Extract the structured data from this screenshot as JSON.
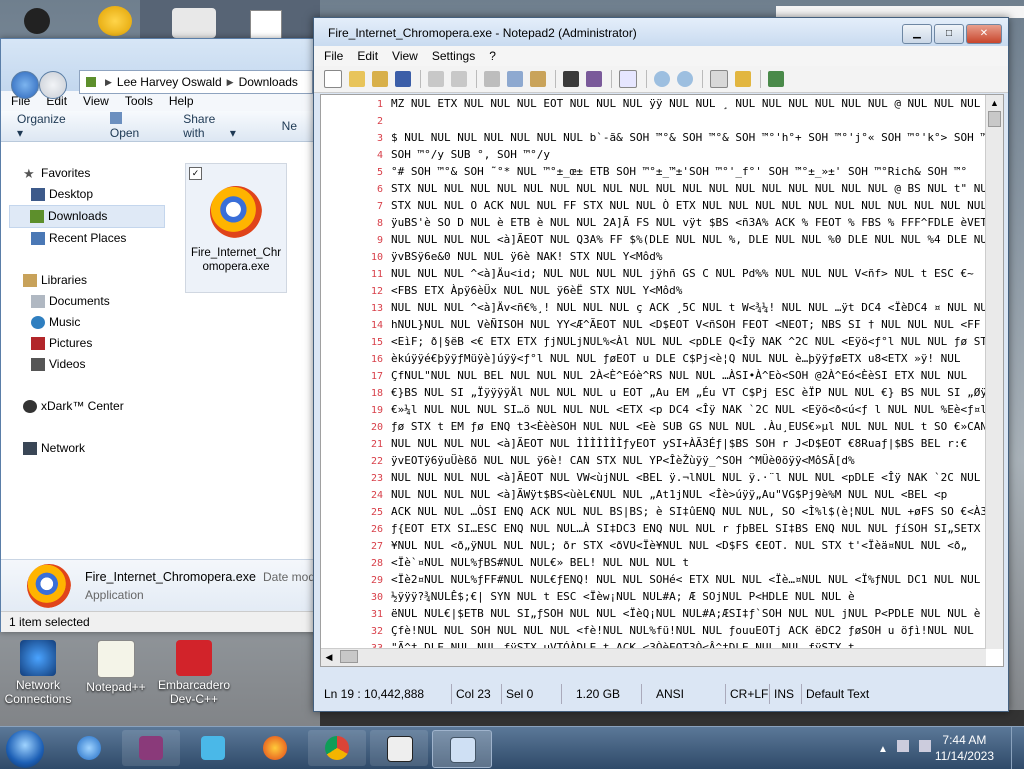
{
  "desktop": {
    "icons": [
      {
        "label": "Network Connections"
      },
      {
        "label": "Notepad++"
      },
      {
        "label": "Embarcadero Dev-C++"
      }
    ]
  },
  "explorer": {
    "breadcrumb": [
      "Lee Harvey Oswald",
      "Downloads"
    ],
    "menu": [
      "File",
      "Edit",
      "View",
      "Tools",
      "Help"
    ],
    "commands": [
      "Organize",
      "Open",
      "Share with",
      "Ne"
    ],
    "nav": {
      "favorites_label": "Favorites",
      "favorites": [
        "Desktop",
        "Downloads",
        "Recent Places"
      ],
      "libraries_label": "Libraries",
      "libraries": [
        "Documents",
        "Music",
        "Pictures",
        "Videos"
      ],
      "xdark": "xDark™ Center",
      "network": "Network"
    },
    "file": {
      "name_line1": "Fire_Internet_Chr",
      "name_line2": "omopera.exe"
    },
    "detail": {
      "name": "Fire_Internet_Chromopera.exe",
      "date_label": "Date mod",
      "type": "Application"
    },
    "status": "1 item selected"
  },
  "notepad": {
    "title": "Fire_Internet_Chromopera.exe - Notepad2 (Administrator)",
    "menu": [
      "File",
      "Edit",
      "View",
      "Settings",
      "?"
    ],
    "lines": [
      {
        "n": "1",
        "t": "MZ NUL ETX NUL NUL NUL EOT NUL NUL NUL ÿÿ NUL NUL ¸ NUL NUL NUL NUL NUL NUL @ NUL NUL NUL NUL"
      },
      {
        "n": "2",
        "t": ""
      },
      {
        "n": "3",
        "t": "$ NUL NUL NUL NUL NUL NUL NUL b`-ã& SOH ™°& SOH ™°& SOH ™°'h°+ SOH ™°'j°« SOH ™°'k°> SOH ™° ¡^"
      },
      {
        "n": "4",
        "t": "SOH ™°/y SUB °, SOH ™°/y"
      },
      {
        "n": "5",
        "t": "°# SOH ™°& SOH ˜°* NUL ™°±_œ± ETB SOH ™°±_™±'SOH ™°'_f°' SOH ™°±_»±' SOH ™°Rich& SOH ™°"
      },
      {
        "n": "6",
        "t": "STX NUL NUL NUL NUL NUL NUL NUL NUL NUL NUL NUL NUL NUL NUL NUL NUL NUL NUL @ BS NUL t\" NUL NUL Aª"
      },
      {
        "n": "7",
        "t": "STX NUL NUL O ACK NUL NUL FF STX NUL NUL Ò ETX NUL NUL NUL NUL NUL NUL NUL NUL NUL NUL NUL NUL @"
      },
      {
        "n": "8",
        "t": "ÿuBS'è SO D NUL è ETB è NUL NUL 2A]Ã FS NUL vÿt $BS <ñ3A% ACK % FEOT % FBS % FFF^FDLE èVETX NUL NUL"
      },
      {
        "n": "9",
        "t": "NUL NUL NUL NUL <à]ÃEOT NUL Q3A% FF $%(DLE NUL NUL %, DLE NUL NUL %0 DLE NUL NUL %4 DLE NUL NUL"
      },
      {
        "n": "10",
        "t": "ÿvBSÿ6e&0 NUL NUL ÿ6è NAK! STX NUL Y<Môd%"
      },
      {
        "n": "11",
        "t": "NUL NUL NUL ^<à]Äu<id; NUL NUL NUL NUL jÿhñ GS C NUL Pd%% NUL NUL NUL V<ñf> NUL t ESC €~"
      },
      {
        "n": "12",
        "t": "<FBS ETX Àpÿ6èÜx NUL NUL ÿ6èË STX NUL Y<Môd%"
      },
      {
        "n": "13",
        "t": "NUL NUL NUL ^<à]Äv<ñ€%¸! NUL NUL NUL ç ACK ¸5C NUL t W<¾¼! NUL NUL …ÿt DC4 <ÏèDC4 ¤ NUL NUL"
      },
      {
        "n": "14",
        "t": "hNUL}NUL NUL VèÑISOH NUL YY<Æ^ÃEOT NUL <D$EOT V<ñSOH FEOT <NEOT; NBS SI † NUL NUL NUL <FF"
      },
      {
        "n": "15",
        "t": "<EìF; ð|§ëB <€ ETX ETX ƒjNULjNUL%<Àl NUL NUL <pDLE Q<Îÿ NAK ^2C NUL <Eÿö<ƒ°l NUL NUL ƒø STX"
      },
      {
        "n": "16",
        "t": "èkúÿÿé€þÿÿƒMüÿè]úÿÿ<ƒ°l NUL NUL ƒøEOT u DLE C$Pj<è¦Q NUL NUL è…þÿÿƒøETX u8<ETX »ÿ! NUL"
      },
      {
        "n": "17",
        "t": "ÇfNUL\"NUL NUL BEL NUL NUL NUL 2À<È^Eóè^RS NUL NUL …ÀSI•À^Eò<SOH @2À^Eó<ÈèSI ETX NUL NUL"
      },
      {
        "n": "18",
        "t": "€}BS NUL SI „ÏÿÿÿÿÄl NUL NUL NUL u EOT „Au EM „Éu VT C$Pj ESC èÏP NUL NUL €} BS NUL SI „Øÿÿÿ€}"
      },
      {
        "n": "19",
        "t": "€»¼l NUL NUL NUL SI…ö NUL NUL NUL <ETX <p DC4 <Îÿ NAK `2C NUL <Eÿö<ð<ú<ƒ l NUL NUL %Eè<ƒ¤l NUL"
      },
      {
        "n": "20",
        "t": "ƒø STX t EM ƒø ENQ t3<ÈèèSOH NUL NUL <Eè SUB GS NUL NUL .Àu¸EUS€»µl NUL NUL NUL t SO €»CAN3 NUL"
      },
      {
        "n": "21",
        "t": "NUL NUL NUL NUL <à]ÃEOT NUL ÌÌÌÌÌÌÌƒyEOT ySI+ÀÃ3Éƒ|$BS SOH r J<D$EOT €8Ruaƒ|$BS BEL r:€"
      },
      {
        "n": "22",
        "t": "ÿvEOTÿ6ÿuÜèßõ NUL NUL ÿ6è! CAN STX NUL YP<ÎèŽùÿÿ_^SOH ^MÜè0öÿÿ<MôSÃ[d%"
      },
      {
        "n": "23",
        "t": "NUL NUL NUL NUL <à]ÃEOT NUL VW<ùjNUL <BEL ÿ.¬lNUL NUL ÿ.·¨l NUL NUL <pDLE <Îÿ NAK `2C NUL <Ïÿ"
      },
      {
        "n": "24",
        "t": "NUL NUL NUL NUL <à]ÃWÿt$BS<ùèL€NUL NUL „At1jNUL <Îè>úÿÿ„Au\"VG$Pj9è%M NUL NUL <BEL <p"
      },
      {
        "n": "25",
        "t": "ACK NUL NUL …ÒSI ENQ ACK NUL NUL BS|BS; è SI‡ûENQ NUL NUL, SO <Ì%l$(è¦NUL NUL +øFS SO €<À3È%D$"
      },
      {
        "n": "26",
        "t": "ƒ{EOT ETX SI…ESC ENQ NUL NUL…À SI‡DC3 ENQ NUL NUL r ƒþBEL SI‡BS ENQ NUL NUL ƒíSOH SI„SETX"
      },
      {
        "n": "27",
        "t": "¥NUL NUL <ð„ÿNUL NUL NUL; ðr STX <ðVU<Ïè¥NUL NUL <D$FS €EOT. NUL STX t'<Ïèä¤NUL NUL <ð„"
      },
      {
        "n": "28",
        "t": "<Ïè`¤NUL NUL%ƒBS#NUL NUL€» BEL! NUL NUL NUL t"
      },
      {
        "n": "29",
        "t": "<Ïè2¤NUL NUL%ƒFF#NUL NUL€ƒENQ! NUL NUL SOHé< ETX NUL NUL <Ïè…¤NUL NUL <Ï%ƒNUL DC1 NUL NUL"
      },
      {
        "n": "30",
        "t": "½ÿÿÿ?¾NULÊ$;€| SYN NUL t ESC <Ïèw¡NUL NUL#A; Æ SOjNUL P<HDLE NUL NUL è"
      },
      {
        "n": "31",
        "t": "ëNUL NUL€|$ETB NUL SI„ƒSOH NUL NUL <ÏèQ¡NUL NUL#A;ÆSI‡ƒ`SOH NUL NUL jNUL P<PDLE NUL NUL è"
      },
      {
        "n": "32",
        "t": "Çfè!NUL NUL SOH NUL NUL NUL <fè!NUL NUL%fü!NUL NUL ƒouuEOTj ACK ëDC2 ƒøSOH u öƒì!NUL NUL"
      },
      {
        "n": "33",
        "t": "\"Ã^† DLE NUL NUL ƒÿSTX uVTÓÀDLE t ACK <3ÒèEOT3Ò<Â^†DLE NUL NUL ƒÿSTX t"
      },
      {
        "n": "34",
        "t": "ÓÀDLE t ENQ 3À@œSTX <Â^†úDLE NUL NUL ÀNUL NUL NUL #€:€ST\"Â^†òDLE NUL NUL ÙNUL NUL NUL NUL"
      }
    ],
    "status": {
      "pos": "Ln 19 : 10,442,888",
      "col": "Col 23",
      "sel": "Sel 0",
      "size": "1.20 GB",
      "encoding": "ANSI",
      "eol": "CR+LF",
      "ovr": "INS",
      "lexer": "Default Text"
    }
  },
  "taskbar": {
    "time": "7:44 AM",
    "date": "11/14/2023"
  }
}
